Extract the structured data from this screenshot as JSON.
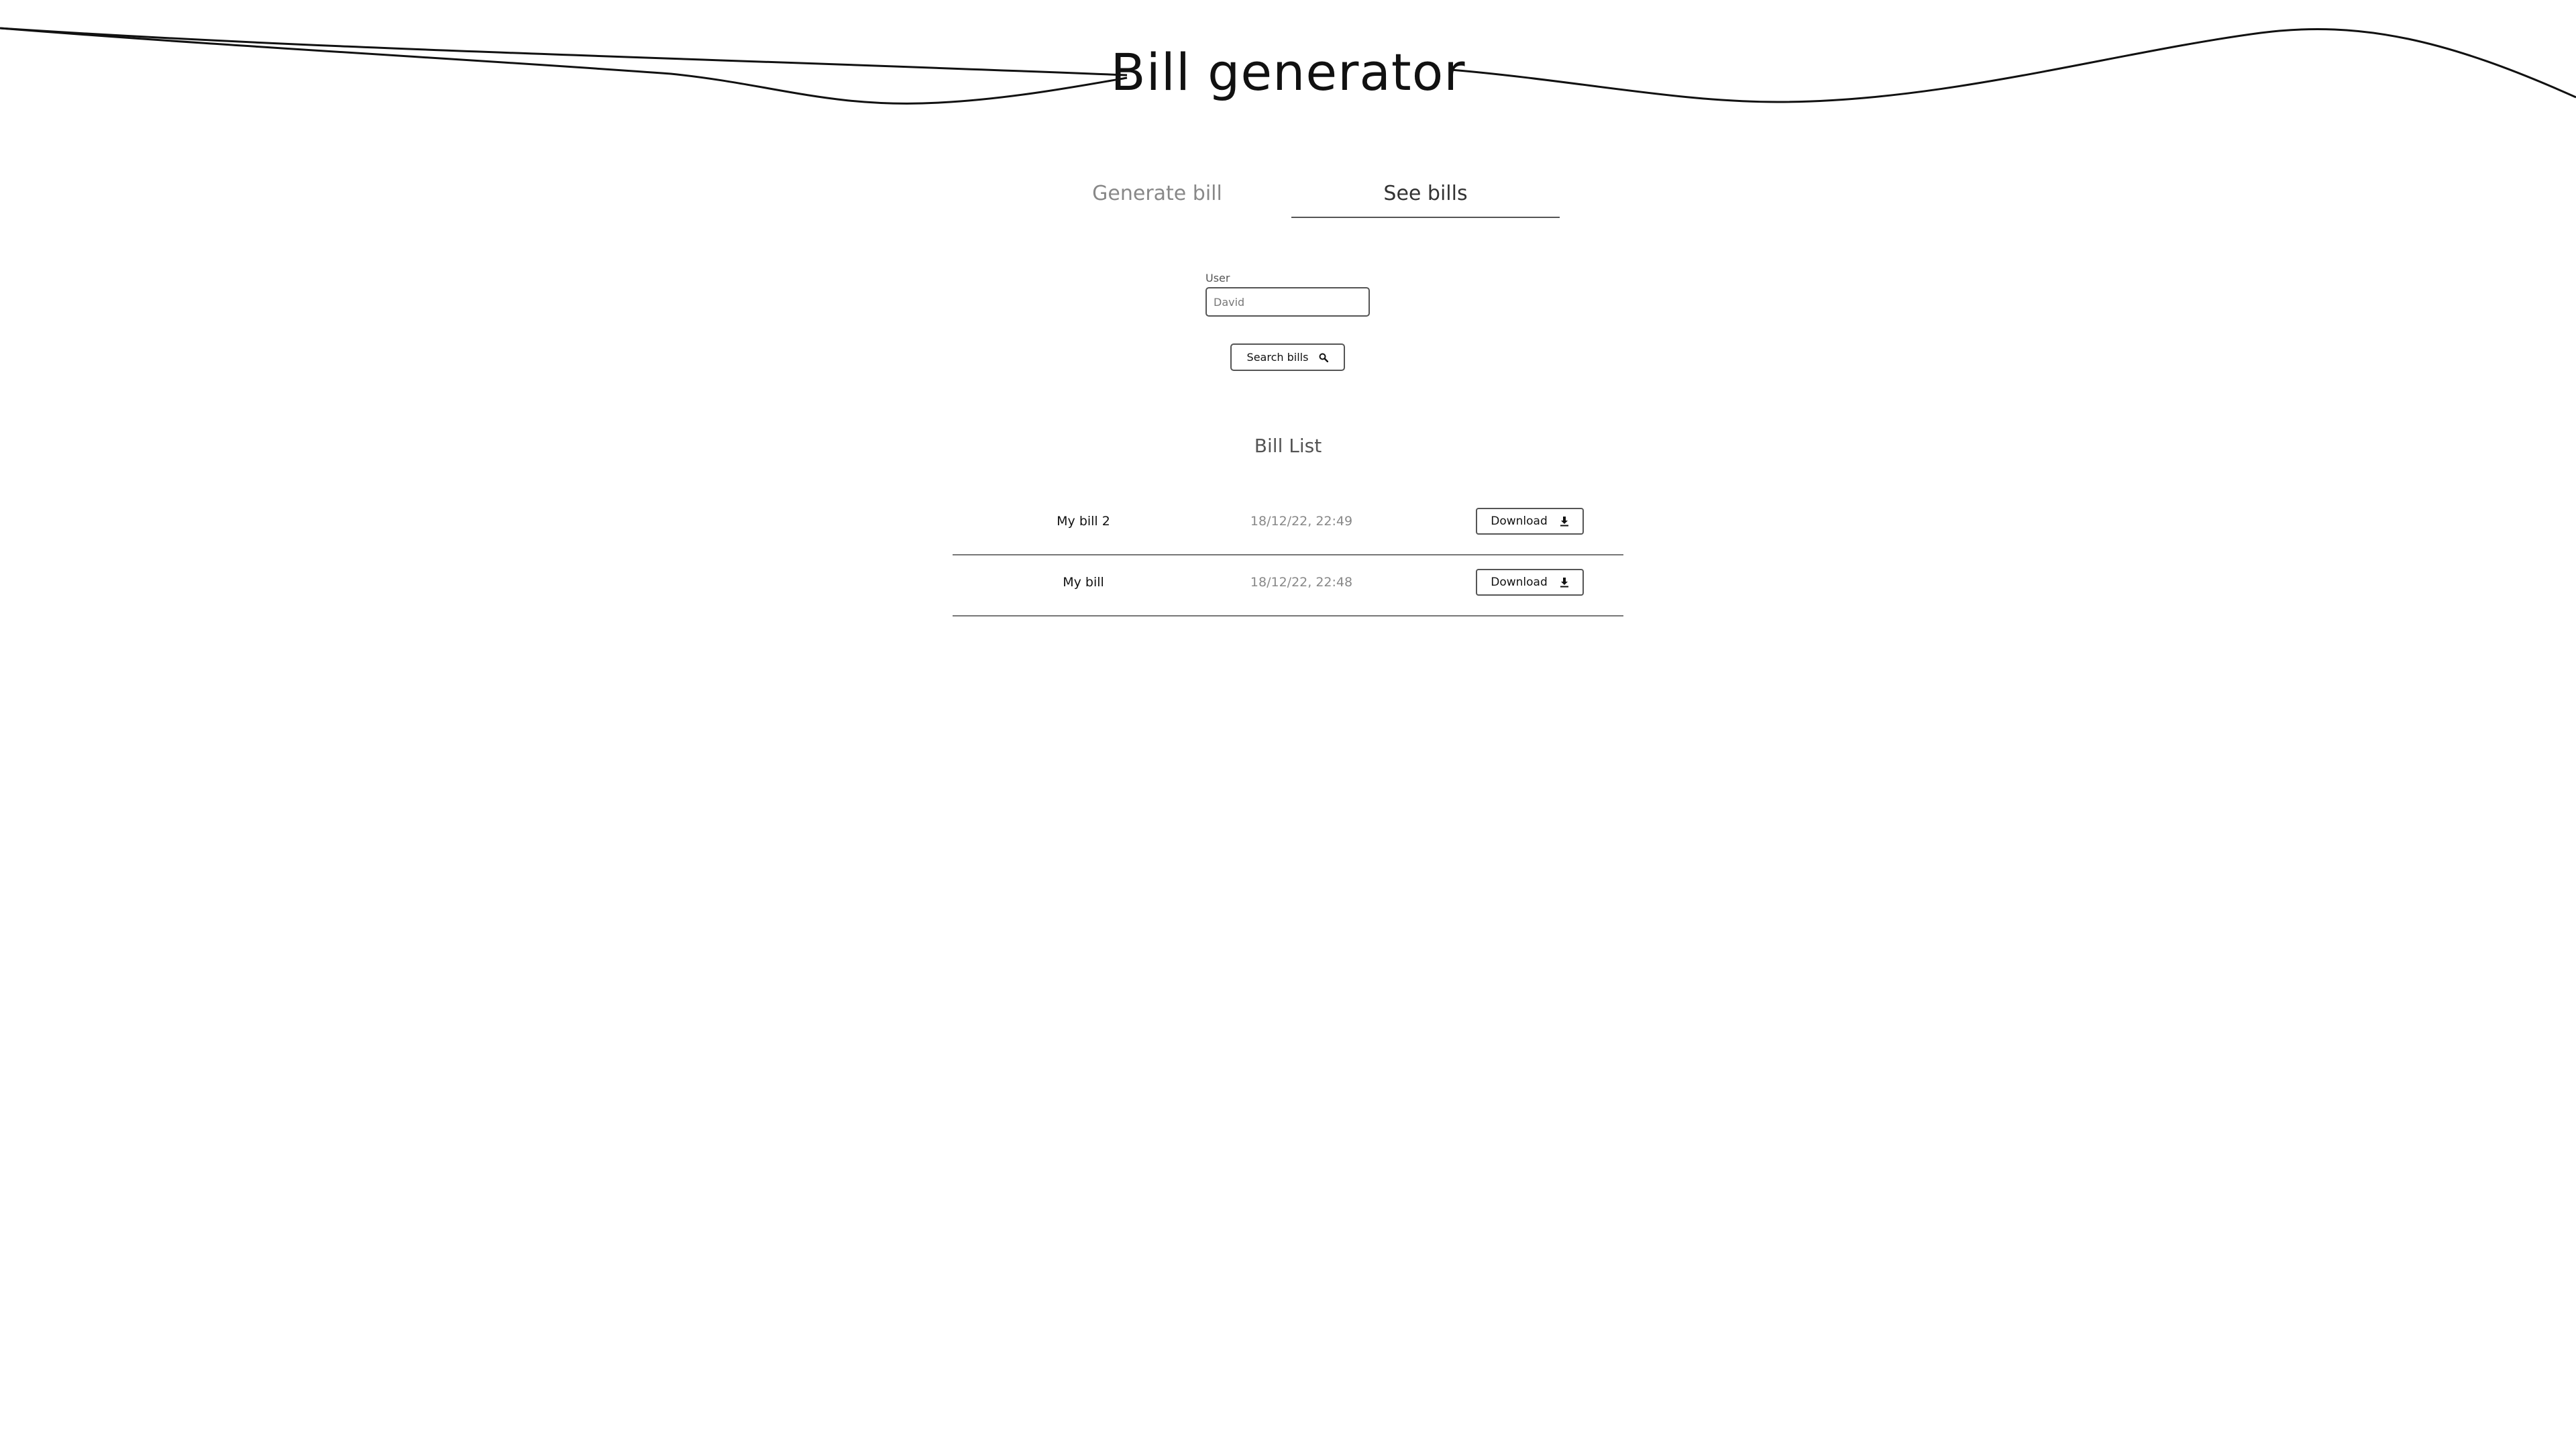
{
  "header": {
    "title": "Bill generator"
  },
  "tabs": [
    {
      "label": "Generate bill",
      "active": false
    },
    {
      "label": "See bills",
      "active": true
    }
  ],
  "search": {
    "user_label": "User",
    "user_value": "David",
    "button_label": "Search bills",
    "button_icon": "search-icon"
  },
  "bill_list": {
    "title": "Bill List",
    "download_label": "Download",
    "download_icon": "download-icon",
    "rows": [
      {
        "name": "My bill 2",
        "date": "18/12/22, 22:49"
      },
      {
        "name": "My bill",
        "date": "18/12/22, 22:48"
      }
    ]
  }
}
